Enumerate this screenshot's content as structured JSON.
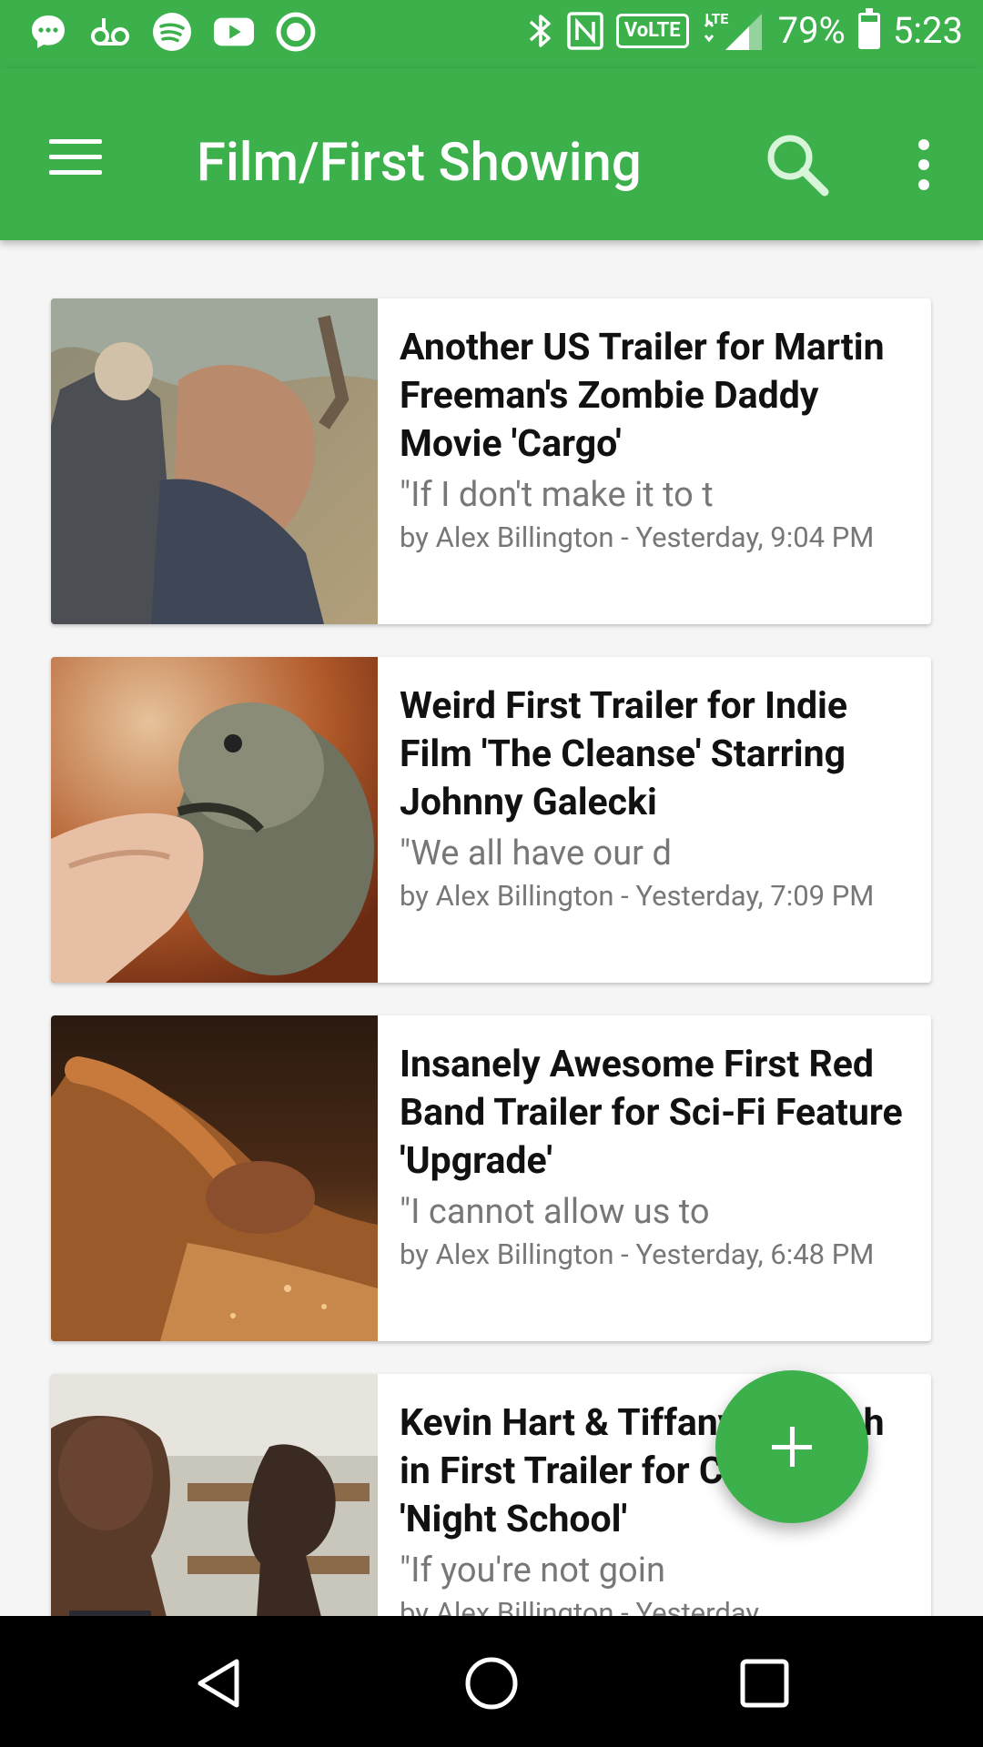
{
  "status_bar": {
    "battery_percent": "79%",
    "time": "5:23",
    "network": "VoLTE",
    "signal_label": "LTE",
    "battery_level": 0.79,
    "left_icons": [
      "messenger-icon",
      "voicemail-icon",
      "spotify-icon",
      "youtube-icon",
      "record-icon"
    ],
    "right_icons": [
      "bluetooth-icon",
      "nfc-icon"
    ]
  },
  "app_bar": {
    "title": "Film/First Showing",
    "menu_icon": "menu-icon",
    "search_icon": "search-icon",
    "more_icon": "more-vert-icon"
  },
  "articles": [
    {
      "title": "Another US Trailer for Martin Freeman's Zombie Daddy Movie 'Cargo'",
      "excerpt": "\"If I don't make it to t",
      "meta": "by Alex Billington - Yesterday, 9:04 PM"
    },
    {
      "title": "Weird First Trailer for Indie Film 'The Cleanse' Starring Johnny Galecki",
      "excerpt": "\"We all have our d",
      "meta": "by Alex Billington - Yesterday, 7:09 PM"
    },
    {
      "title": "Insanely Awesome First Red Band Trailer for Sci-Fi Feature 'Upgrade'",
      "excerpt": "\"I cannot allow us to",
      "meta": "by Alex Billington - Yesterday, 6:48 PM"
    },
    {
      "title": "Kevin Hart & Tiffany Haddish in First Trailer for Comedy 'Night School'",
      "excerpt": "\"If you're not goin",
      "meta": "by Alex Billington - Yesterday,"
    }
  ],
  "fab": {
    "icon": "add-icon"
  },
  "nav_bar": {
    "icons": [
      "back-icon",
      "home-icon",
      "recents-icon"
    ]
  },
  "colors": {
    "primary": "#3bb04b",
    "title_text": "#111111",
    "secondary_text": "#777777"
  }
}
